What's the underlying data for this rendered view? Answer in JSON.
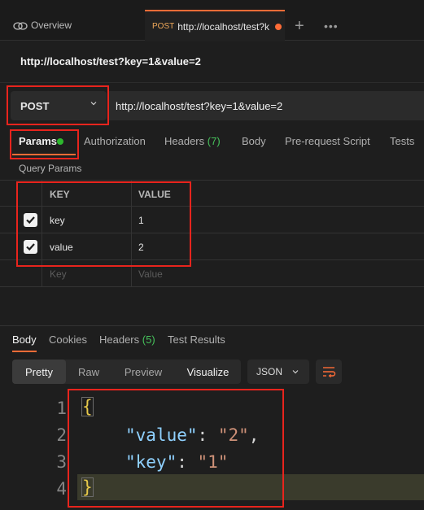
{
  "tabs": {
    "overview_label": "Overview",
    "active": {
      "method": "POST",
      "url": "http://localhost/test?k"
    }
  },
  "request": {
    "title": "http://localhost/test?key=1&value=2",
    "method": "POST",
    "url": "http://localhost/test?key=1&value=2"
  },
  "request_tabs": {
    "params": "Params",
    "authorization": "Authorization",
    "headers": "Headers",
    "headers_count": "(7)",
    "body": "Body",
    "prerequest": "Pre-request Script",
    "tests": "Tests"
  },
  "query_params": {
    "title": "Query Params",
    "headers": {
      "key": "KEY",
      "value": "VALUE"
    },
    "rows": [
      {
        "key": "key",
        "value": "1",
        "checked": true
      },
      {
        "key": "value",
        "value": "2",
        "checked": true
      }
    ],
    "placeholder": {
      "key": "Key",
      "value": "Value"
    }
  },
  "response_tabs": {
    "body": "Body",
    "cookies": "Cookies",
    "headers": "Headers",
    "headers_count": "(5)",
    "test_results": "Test Results"
  },
  "view_modes": {
    "pretty": "Pretty",
    "raw": "Raw",
    "preview": "Preview",
    "visualize": "Visualize"
  },
  "format": "JSON",
  "code": {
    "line_numbers": [
      "1",
      "2",
      "3",
      "4"
    ],
    "open_brace": "{",
    "close_brace": "}",
    "line2": {
      "key": "\"value\"",
      "colon": ": ",
      "value": "\"2\"",
      "comma": ","
    },
    "line3": {
      "key": "\"key\"",
      "colon": ": ",
      "value": "\"1\""
    }
  },
  "colors": {
    "accent": "#ff6c37",
    "annotation": "#e8241d",
    "status_green": "#2eb82e"
  }
}
